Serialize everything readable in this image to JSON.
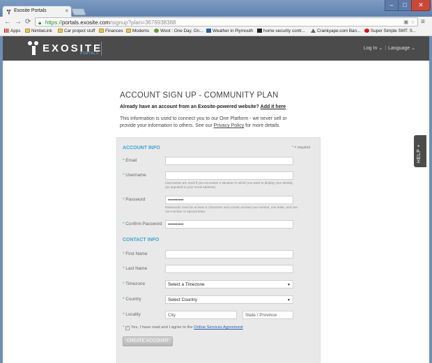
{
  "browser": {
    "tab_title": "Exosite Portals",
    "tab_close": "×",
    "url_scheme": "https://",
    "url_host": "portals.exosite.com",
    "url_path": "/signup?plan=3676938388",
    "window_controls": {
      "minimize": "–",
      "maximize": "□",
      "close": "✕"
    },
    "nav": {
      "back": "←",
      "forward": "→",
      "reload": "⟳"
    },
    "bookmarks": [
      {
        "label": "Apps",
        "icon": "apps-grid-icon"
      },
      {
        "label": "NimbeLink",
        "icon": "folder-icon"
      },
      {
        "label": "Car project stuff",
        "icon": "folder-icon"
      },
      {
        "label": "Finances",
        "icon": "folder-icon"
      },
      {
        "label": "Modems",
        "icon": "folder-icon"
      },
      {
        "label": "Woot : One Day, On...",
        "icon": "woot-icon"
      },
      {
        "label": "Weather in Plymouth",
        "icon": "weather-icon"
      },
      {
        "label": "home security contr...",
        "icon": "security-icon"
      },
      {
        "label": "Crankyape.com Ban...",
        "icon": "crankyape-icon"
      },
      {
        "label": "Super Simple SMT: S...",
        "icon": "red-dot-icon"
      }
    ]
  },
  "header": {
    "logo_text": "EXOSITE",
    "logo_sub": "PORTALS",
    "login": "Log In",
    "language": "Language"
  },
  "main": {
    "heading": "ACCOUNT SIGN UP - COMMUNITY PLAN",
    "already_text": "Already have an account from an Exosite-powered website?",
    "already_link": "Add it here",
    "info_text": "This information is used to connect you to our One Platform - we never sell or provide your information to others. See our",
    "privacy_link": "Privacy Policy",
    "info_tail": "for more details."
  },
  "form": {
    "account_section": "ACCOUNT INFO",
    "required_note": "= required",
    "email_label": "Email",
    "username_label": "Username",
    "username_hint": "Usernames are used if you encounter a situation in which you want to display your identity (as opposed to your email address).",
    "password_label": "Password",
    "password_value": "••••••••••",
    "password_hint": "Passwords must be at least 8 characters and contain at least one number, one letter, and one non-number or special letter.",
    "confirm_label": "Confirm Password",
    "confirm_value": "••••••••••",
    "contact_section": "CONTACT INFO",
    "first_name_label": "First Name",
    "last_name_label": "Last Name",
    "timezone_label": "Timezone",
    "timezone_value": "Select a Timezone",
    "country_label": "Country",
    "country_value": "Select Country",
    "locality_label": "Locality",
    "city_placeholder": "City",
    "state_placeholder": "State / Province",
    "agree_text": "Yes, I have read and I agree to the",
    "agree_link": "Online Services Agreement",
    "submit_label": "CREATE ACCOUNT"
  },
  "help_tab": "HELP +"
}
